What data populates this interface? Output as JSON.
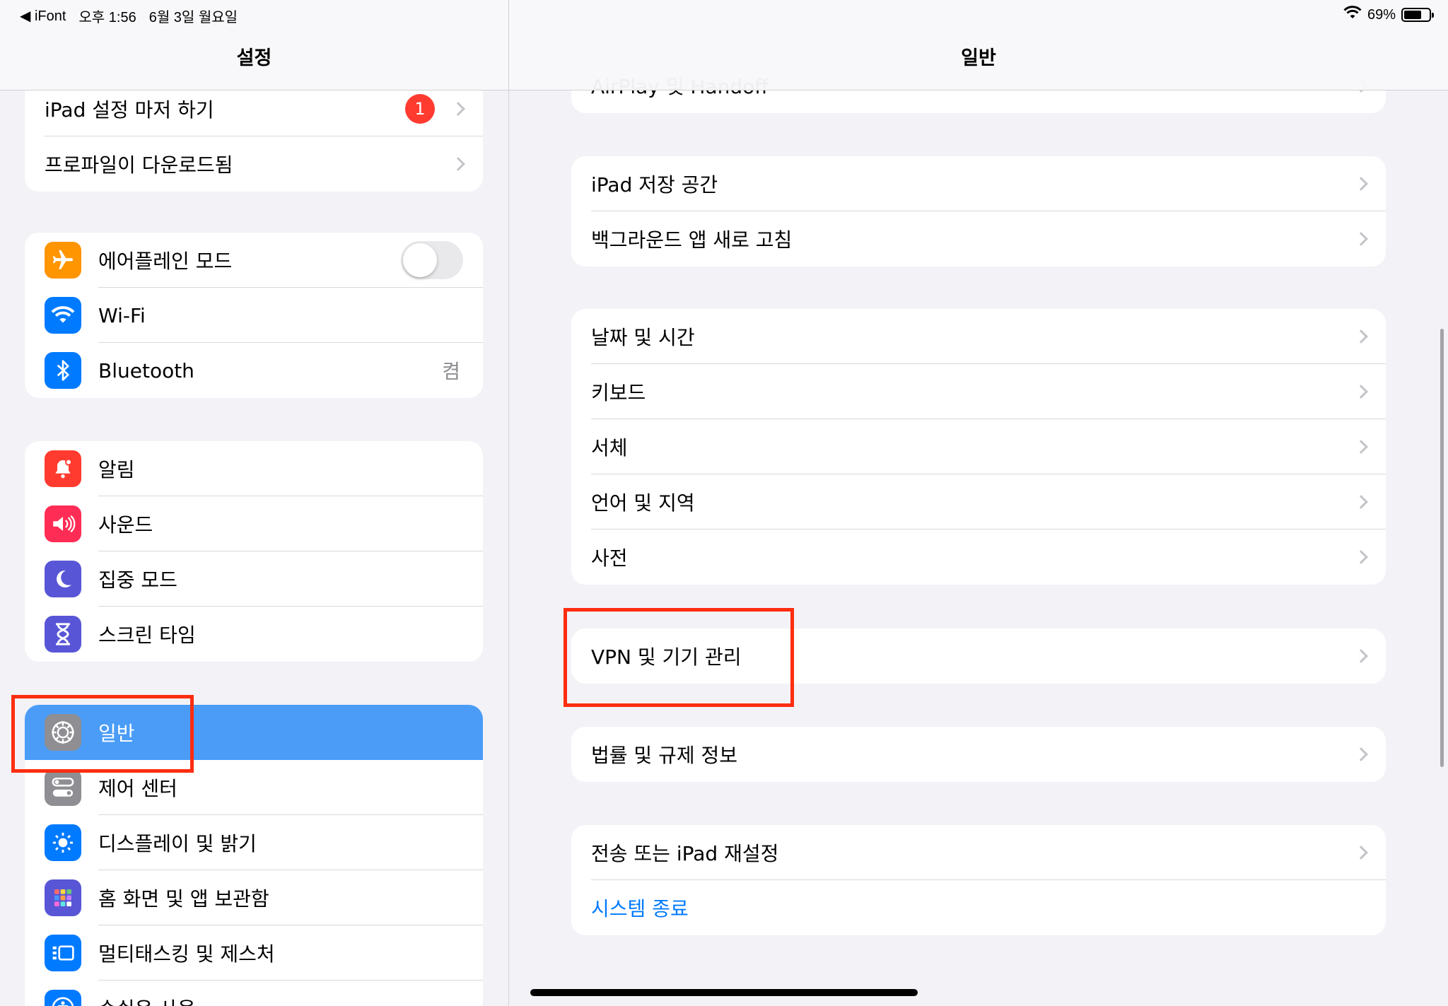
{
  "status": {
    "back_app": "◀ iFont",
    "time": "오후 1:56",
    "date": "6월 3일 월요일",
    "battery": "69%",
    "battery_level": 0.69
  },
  "sidebar": {
    "title": "설정",
    "group1": [
      {
        "label": "iPad 설정 마저 하기",
        "badge": "1"
      },
      {
        "label": "프로파일이 다운로드됨"
      }
    ],
    "group2": [
      {
        "label": "에어플레인 모드",
        "icon": "airplane-icon",
        "color": "#ff9500",
        "toggle": false
      },
      {
        "label": "Wi-Fi",
        "icon": "wifi-icon",
        "color": "#007aff"
      },
      {
        "label": "Bluetooth",
        "icon": "bluetooth-icon",
        "color": "#007aff",
        "value": "켬"
      }
    ],
    "group3": [
      {
        "label": "알림",
        "icon": "bell-icon",
        "color": "#ff3b30"
      },
      {
        "label": "사운드",
        "icon": "speaker-icon",
        "color": "#ff2d55"
      },
      {
        "label": "집중 모드",
        "icon": "moon-icon",
        "color": "#5856d6"
      },
      {
        "label": "스크린 타임",
        "icon": "hourglass-icon",
        "color": "#5856d6"
      }
    ],
    "group4": [
      {
        "label": "일반",
        "icon": "gear-icon",
        "color": "#8e8e93",
        "selected": true
      },
      {
        "label": "제어 센터",
        "icon": "toggles-icon",
        "color": "#8e8e93"
      },
      {
        "label": "디스플레이 및 밝기",
        "icon": "sun-icon",
        "color": "#007aff"
      },
      {
        "label": "홈 화면 및 앱 보관함",
        "icon": "grid-icon",
        "color": "#5856d6"
      },
      {
        "label": "멀티태스킹 및 제스처",
        "icon": "multitask-icon",
        "color": "#007aff"
      },
      {
        "label": "손쉬운 사용",
        "icon": "accessibility-icon",
        "color": "#007aff"
      }
    ]
  },
  "detail": {
    "title": "일반",
    "partial_row": "AirPlay 및 Handoff",
    "group1": [
      "iPad 저장 공간",
      "백그라운드 앱 새로 고침"
    ],
    "group2": [
      "날짜 및 시간",
      "키보드",
      "서체",
      "언어 및 지역",
      "사전"
    ],
    "group3": [
      "VPN 및 기기 관리"
    ],
    "group4": [
      "법률 및 규제 정보"
    ],
    "group5": [
      "전송 또는 iPad 재설정"
    ],
    "shutdown": "시스템 종료"
  },
  "colors": {
    "accent": "#007aff",
    "selected_row": "#4a9cf7",
    "highlight_box": "#ff2d10",
    "badge": "#ff3b30"
  }
}
